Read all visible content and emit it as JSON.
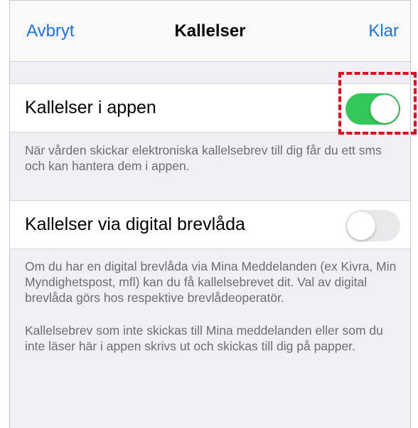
{
  "navbar": {
    "cancel_label": "Avbryt",
    "title": "Kallelser",
    "done_label": "Klar"
  },
  "settings": [
    {
      "label": "Kallelser i appen",
      "enabled": true,
      "footer": "När vården skickar elektroniska kallelsebrev till dig får du ett sms och kan hantera dem i appen."
    },
    {
      "label": "Kallelser via digital brevlåda",
      "enabled": false,
      "footer": "Om du har en digital brevlåda via Mina Meddelanden (ex Kivra, Min Myndighetspost, mfl) kan du få kallelsebrevet dit. Val av digital brevlåda görs hos respektive brevlådeoperatör."
    }
  ],
  "footer_note": "Kallelsebrev som inte skickas till Mina meddelanden eller som du inte läser här i appen skrivs ut och skickas till dig på papper.",
  "colors": {
    "accent": "#1a73e8",
    "toggle_on": "#34c759",
    "toggle_off": "#e9e9eb",
    "highlight": "#e8001c",
    "background": "#efeff4"
  }
}
